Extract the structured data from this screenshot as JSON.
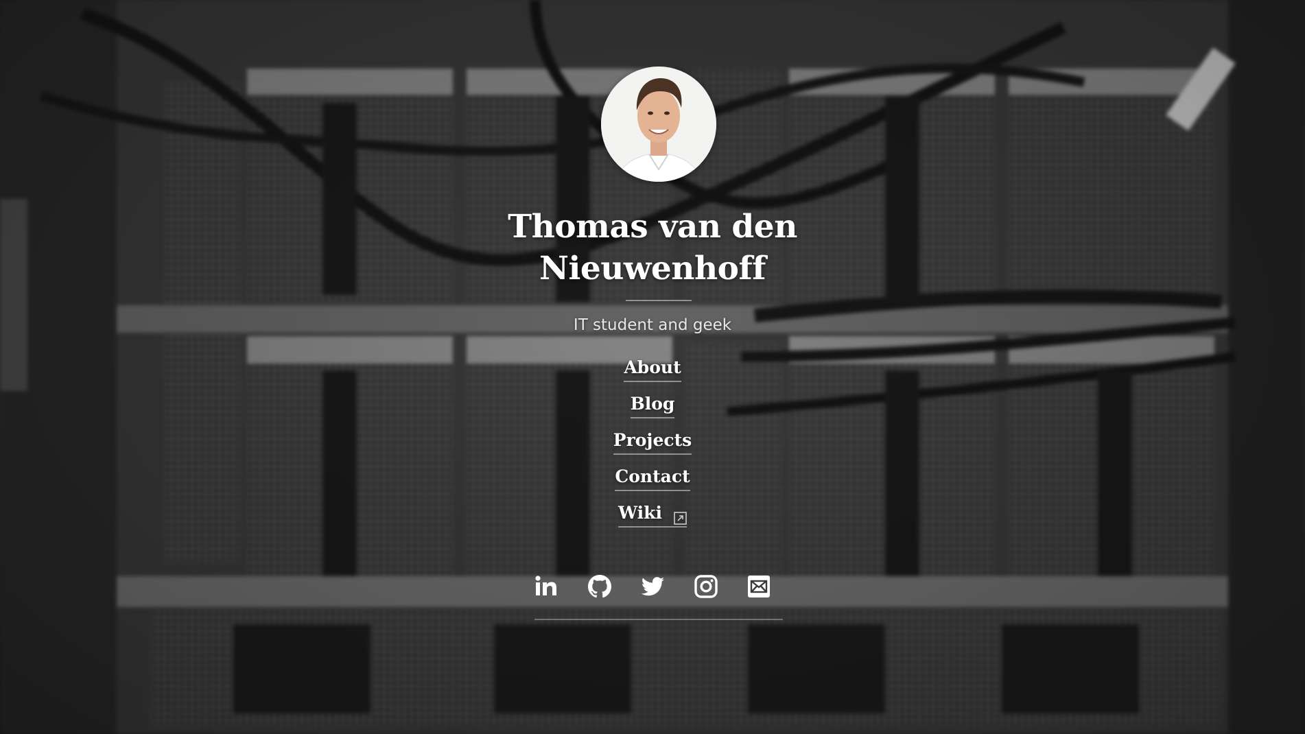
{
  "profile": {
    "name_line1": "Thomas van den",
    "name_line2": "Nieuwenhoff",
    "tagline": "IT student and geek"
  },
  "nav": {
    "items": [
      {
        "label": "About"
      },
      {
        "label": "Blog"
      },
      {
        "label": "Projects"
      },
      {
        "label": "Contact"
      },
      {
        "label": "Wiki",
        "icon": "external-link-icon"
      }
    ]
  },
  "social": {
    "icons": [
      "linkedin-icon",
      "github-icon",
      "twitter-icon",
      "instagram-icon",
      "email-icon"
    ]
  },
  "colors": {
    "text": "#ffffff",
    "background": "#3a3a3a"
  }
}
